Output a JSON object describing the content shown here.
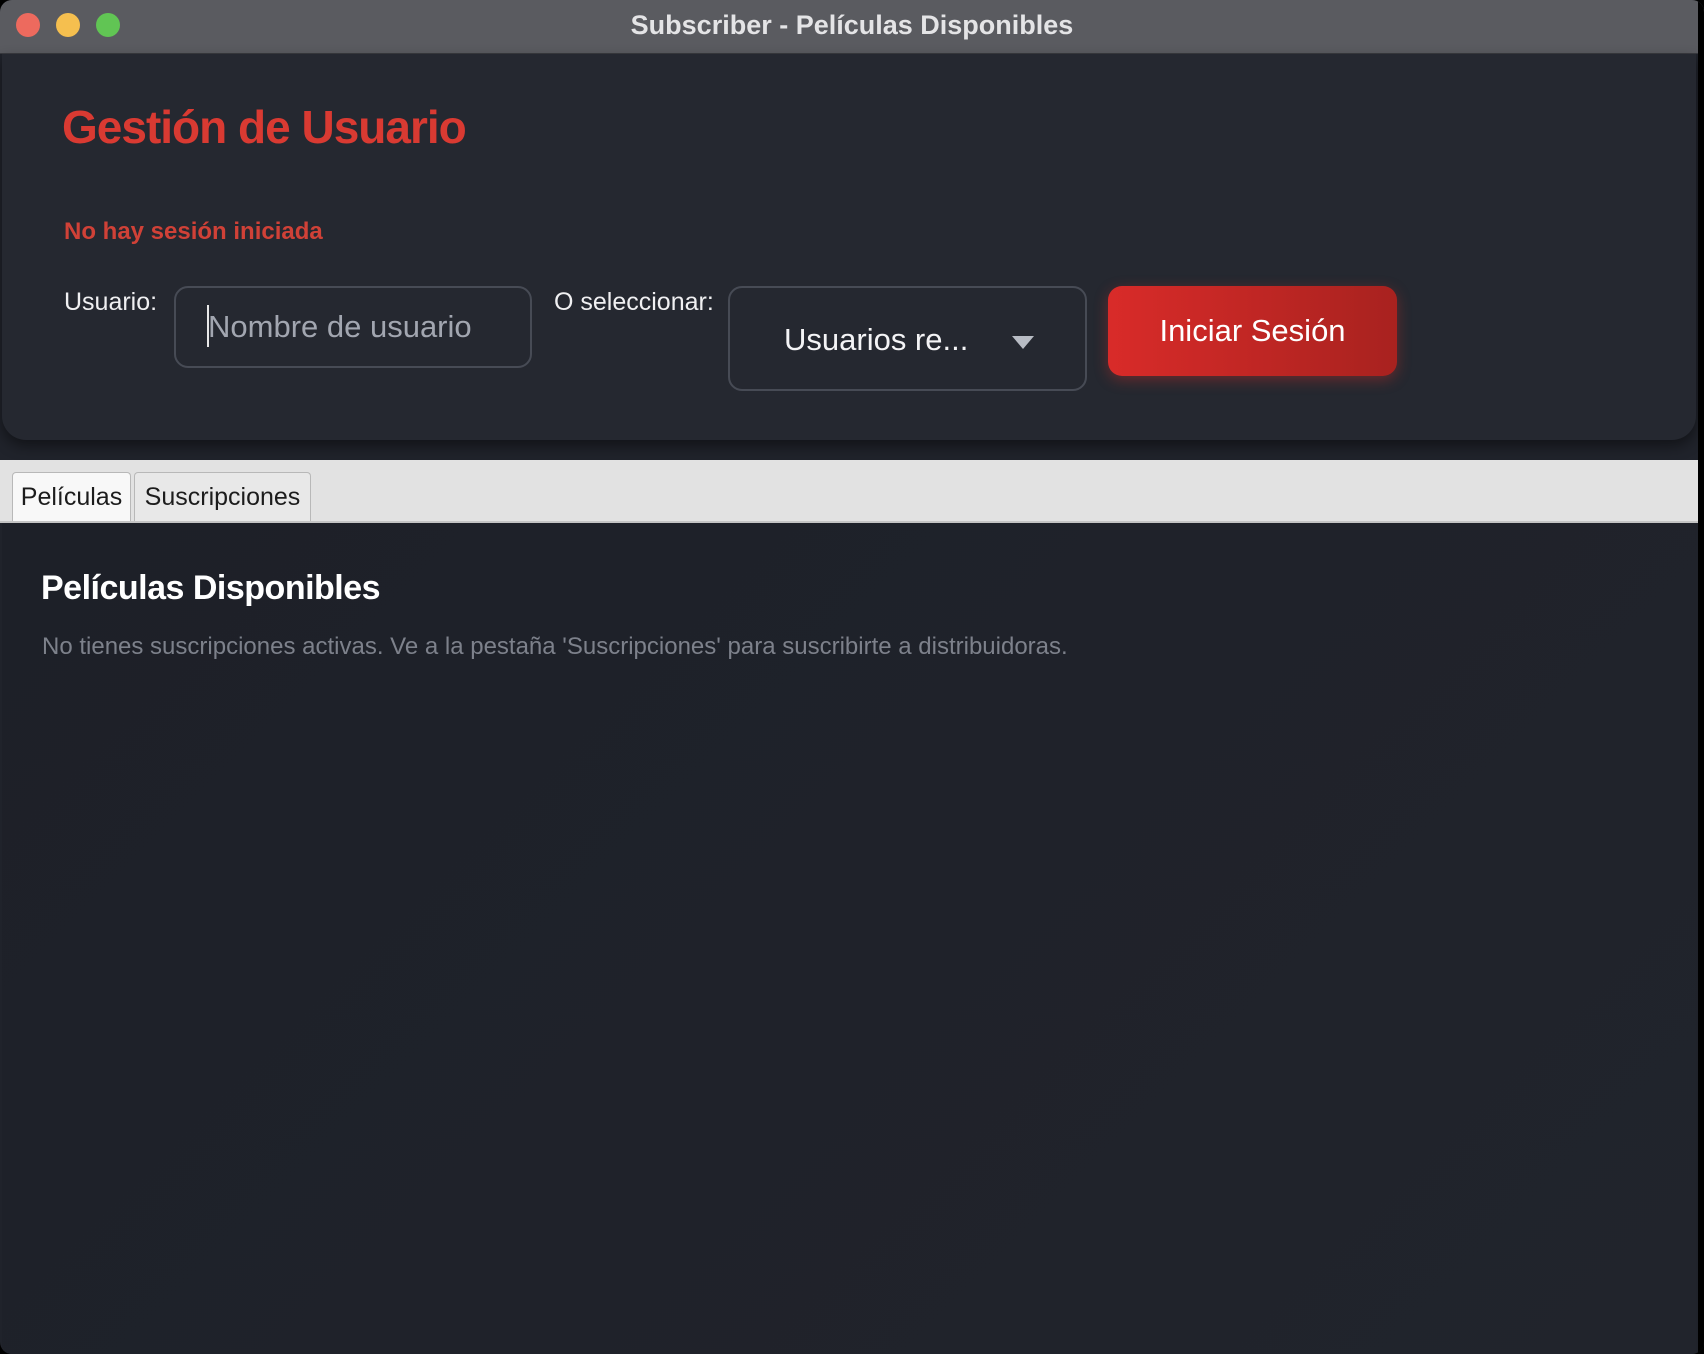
{
  "window": {
    "title": "Subscriber - Películas Disponibles"
  },
  "header": {
    "title": "Gestión de Usuario",
    "session_status": "No hay sesión iniciada",
    "user_label": "Usuario:",
    "user_input": {
      "value": "",
      "placeholder": "Nombre de usuario"
    },
    "select_label": "O seleccionar:",
    "select": {
      "selected": "Usuarios re..."
    },
    "login_button": "Iniciar Sesión"
  },
  "tabs": [
    {
      "label": "Películas",
      "active": true
    },
    {
      "label": "Suscripciones",
      "active": false
    }
  ],
  "content": {
    "title": "Películas Disponibles",
    "message": "No tienes suscripciones activas. Ve a la pestaña 'Suscripciones' para suscribirte a distribuidoras."
  },
  "colors": {
    "accent": "#d93a32",
    "background": "#20232b",
    "button_gradient_start": "#d92b29",
    "button_gradient_end": "#a8221f"
  },
  "icons": {
    "select_arrow": "chevron-down-icon"
  }
}
